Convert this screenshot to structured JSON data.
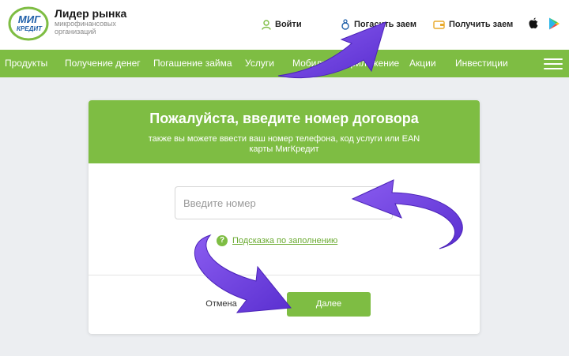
{
  "brand": {
    "logo_line1": "МИГ",
    "logo_line2": "КРЕДИТ",
    "title": "Лидер рынка",
    "subtitle": "микрофинансовых организаций"
  },
  "header_links": {
    "login": "Войти",
    "repay": "Погасить заем",
    "get_loan": "Получить заем"
  },
  "nav": {
    "items": [
      "Продукты",
      "Получение денег",
      "Погашение займа",
      "Услуги",
      "Мобильное приложение",
      "Акции",
      "Инвестиции"
    ]
  },
  "card": {
    "title": "Пожалуйста, введите номер договора",
    "subtitle": "также вы можете ввести ваш номер телефона, код услуги или EAN карты МигКредит",
    "input_placeholder": "Введите номер",
    "hint": "Подсказка по заполнению",
    "cancel": "Отмена",
    "next": "Далее"
  },
  "colors": {
    "brand_green": "#7ebd43",
    "logo_blue": "#1f5fa8",
    "arrow_purple": "#6b3fe0"
  },
  "icons": [
    "user-icon",
    "coin-stack-icon",
    "wallet-icon",
    "apple-icon",
    "google-play-icon",
    "question-icon",
    "hamburger-menu-icon"
  ]
}
